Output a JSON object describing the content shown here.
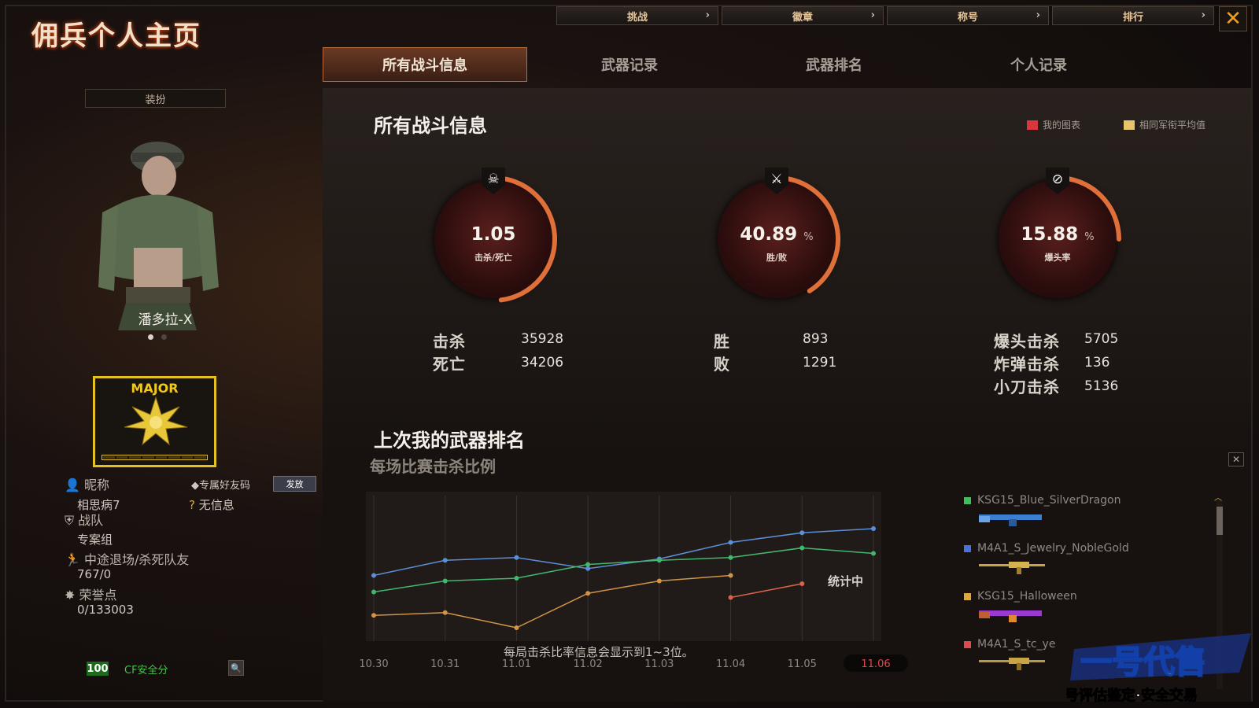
{
  "title": "佣兵个人主页",
  "top_nav": [
    {
      "label": "挑战"
    },
    {
      "label": "徽章"
    },
    {
      "label": "称号"
    },
    {
      "label": "排行"
    }
  ],
  "tabs": [
    {
      "label": "所有战斗信息",
      "active": true
    },
    {
      "label": "武器记录"
    },
    {
      "label": "武器排名"
    },
    {
      "label": "个人记录"
    }
  ],
  "left": {
    "dress_button": "装扮",
    "character_name": "潘多拉-X",
    "rank": "MAJOR",
    "nickname_label": "昵称",
    "nickname": "相思病7",
    "friend_code_label": "专属好友码",
    "send_button": "发放",
    "friend_code_value": "无信息",
    "team_label": "战队",
    "team": "专案组",
    "quit_label": "中途退场/杀死队友",
    "quit_value": "767/0",
    "honor_label": "荣誉点",
    "honor_value": "0/133003",
    "security_score": "100",
    "security_label": "CF安全分"
  },
  "main": {
    "heading": "所有战斗信息",
    "legend": [
      {
        "label": "我的图表",
        "color": "#d9363e"
      },
      {
        "label": "相同军衔平均值",
        "color": "#e8c36a"
      }
    ],
    "gauges": [
      {
        "value": "1.05",
        "unit": "",
        "label": "击杀/死亡",
        "fraction": 0.48
      },
      {
        "value": "40.89",
        "unit": "%",
        "label": "胜/败",
        "fraction": 0.41
      },
      {
        "value": "15.88",
        "unit": "%",
        "label": "爆头率",
        "fraction": 0.25
      }
    ],
    "stats_kd": [
      {
        "label": "击杀",
        "value": "35928"
      },
      {
        "label": "死亡",
        "value": "34206"
      }
    ],
    "stats_wl": [
      {
        "label": "胜",
        "value": "893"
      },
      {
        "label": "败",
        "value": "1291"
      }
    ],
    "stats_hs": [
      {
        "label": "爆头击杀",
        "value": "5705"
      },
      {
        "label": "炸弹击杀",
        "value": "136"
      },
      {
        "label": "小刀击杀",
        "value": "5136"
      }
    ],
    "rank_heading": "上次我的武器排名",
    "rank_sub": "每场比赛击杀比例",
    "chart_note": "每局击杀比率信息会显示到1~3位。",
    "chart_status": "统计中"
  },
  "chart_data": {
    "type": "line",
    "categories": [
      "10.30",
      "10.31",
      "11.01",
      "11.02",
      "11.03",
      "11.04",
      "11.05",
      "11.06"
    ],
    "series": [
      {
        "name": "KSG15_Blue_SilverDragon",
        "color": "#5b8fd8",
        "values": [
          0.42,
          0.53,
          0.55,
          0.47,
          0.54,
          0.66,
          0.73,
          0.76
        ]
      },
      {
        "name": "M4A1_S_Jewelry_NobleGold",
        "color": "#41b86e",
        "values": [
          0.3,
          0.38,
          0.4,
          0.5,
          0.53,
          0.55,
          0.62,
          0.58
        ]
      },
      {
        "name": "KSG15_Halloween",
        "color": "#d09548",
        "values": [
          0.13,
          0.15,
          0.04,
          0.29,
          0.38,
          0.42,
          null,
          null
        ]
      },
      {
        "name": "M4A1_S_tc_ye",
        "color": "#d6634a",
        "values": [
          null,
          null,
          null,
          null,
          null,
          0.26,
          0.36,
          null
        ]
      }
    ],
    "selected": "11.06",
    "ylim": [
      0,
      1
    ]
  },
  "weapons": [
    {
      "name": "KSG15_Blue_SilverDragon",
      "color": "#3fbf5a"
    },
    {
      "name": "M4A1_S_Jewelry_NobleGold",
      "color": "#4a6fe0"
    },
    {
      "name": "KSG15_Halloween",
      "color": "#e0a838"
    },
    {
      "name": "M4A1_S_tc_ye",
      "color": "#e04a4a"
    }
  ],
  "watermark": {
    "logo": "一号代售",
    "tagline": "账号评估鉴定·安全交易"
  },
  "icons": {
    "gauge1": "skull-crossbones-icon",
    "gauge2": "crossed-swords-icon",
    "gauge3": "headshot-icon",
    "nickname": "person-icon",
    "friend_code": "tag-icon",
    "friend_value": "question-icon",
    "team": "shield-icon",
    "quit": "running-icon",
    "honor": "star-icon",
    "security": "search-icon"
  }
}
